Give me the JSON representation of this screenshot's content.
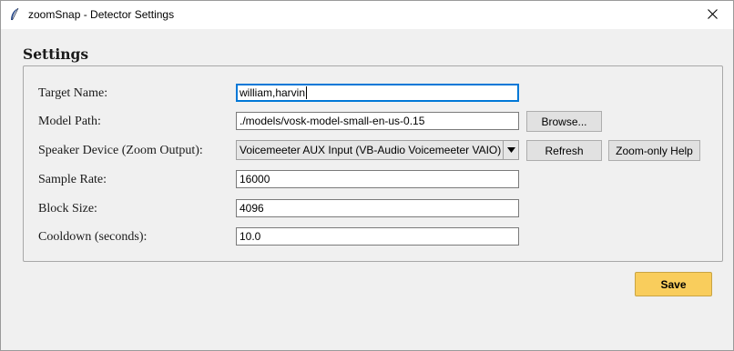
{
  "window": {
    "title": "zoomSnap - Detector Settings",
    "icons": {
      "app": "feather-icon",
      "close": "close-icon"
    }
  },
  "settings": {
    "group_title": "Settings",
    "target_name": {
      "label": "Target Name:",
      "value": "william,harvin"
    },
    "model_path": {
      "label": "Model Path:",
      "value": "./models/vosk-model-small-en-us-0.15",
      "browse_label": "Browse..."
    },
    "speaker_device": {
      "label": "Speaker Device (Zoom Output):",
      "selected": "Voicemeeter AUX Input (VB-Audio Voicemeeter VAIO)",
      "refresh_label": "Refresh",
      "help_label": "Zoom-only Help"
    },
    "sample_rate": {
      "label": "Sample Rate:",
      "value": "16000"
    },
    "block_size": {
      "label": "Block Size:",
      "value": "4096"
    },
    "cooldown": {
      "label": "Cooldown (seconds):",
      "value": "10.0"
    }
  },
  "footer": {
    "save_label": "Save"
  },
  "colors": {
    "save_button": "#f9cd5c",
    "focus_border": "#0078d7",
    "background": "#f0f0f0"
  }
}
